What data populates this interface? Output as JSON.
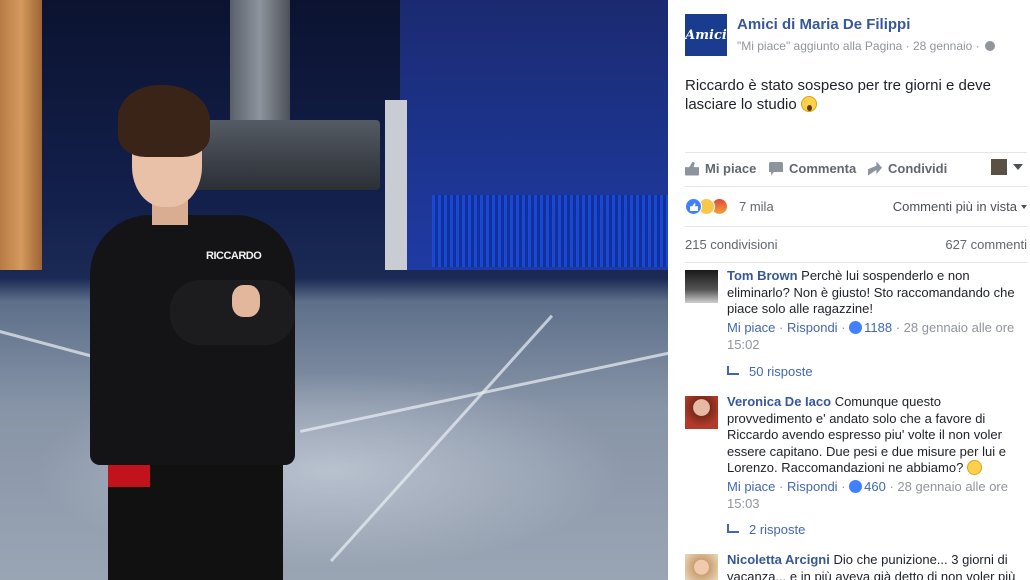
{
  "photo": {
    "shirt_text": "RICCARDO"
  },
  "post": {
    "page_name": "Amici di Maria De Filippi",
    "avatar_text": "Amici",
    "meta": "\"Mi piace\" aggiunto alla Pagina · 28 gennaio ·",
    "text": "Riccardo è stato sospeso per tre giorni e deve lasciare lo studio"
  },
  "actions": {
    "like": "Mi piace",
    "comment": "Commenta",
    "share": "Condividi"
  },
  "reactions": {
    "count": "7 mila",
    "filter": "Commenti più in vista"
  },
  "stats": {
    "shares": "215 condivisioni",
    "comments": "627 commenti"
  },
  "comments": [
    {
      "author": "Tom Brown",
      "text": "Perchè lui sospenderlo e non eliminarlo? Non è giusto! Sto raccomandando che piace solo alle ragazzine!",
      "like_label": "Mi piace",
      "reply_label": "Rispondi",
      "likes": "1188",
      "time": "28 gennaio alle ore 15:02",
      "replies": "50 risposte"
    },
    {
      "author": "Veronica De Iaco",
      "text": "Comunque questo provvedimento e' andato solo che a favore di Riccardo avendo espresso piu' volte il non voler essere capitano. Due pesi e due misure per lui e Lorenzo. Raccomandazioni ne abbiamo?",
      "like_label": "Mi piace",
      "reply_label": "Rispondi",
      "likes": "460",
      "time": "28 gennaio alle ore 15:03",
      "replies": "2 risposte"
    },
    {
      "author": "Nicoletta Arcigni",
      "text": "Dio che punizione... 3 giorni di vacanza... e in più aveva già detto di non voler più"
    }
  ],
  "colors": {
    "link_blue": "#365899",
    "action_blue": "#4267b2",
    "gray_text": "#90949c",
    "brand_blue": "#1a3c8e"
  }
}
